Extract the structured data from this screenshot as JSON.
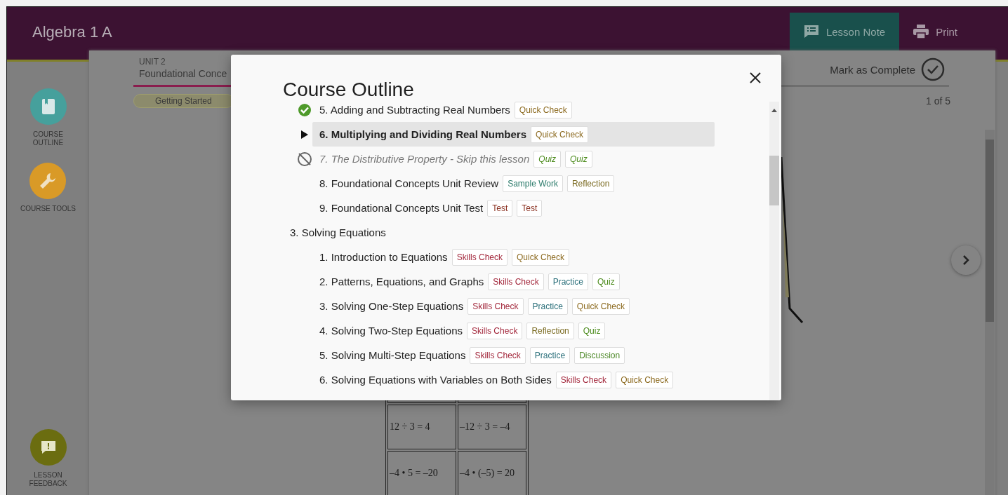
{
  "header": {
    "title": "Algebra 1 A",
    "actions": [
      {
        "label": "Lesson Note",
        "kind": "note",
        "selected": true
      },
      {
        "label": "Print",
        "kind": "print",
        "selected": false
      }
    ]
  },
  "sidebar": {
    "top": [
      {
        "label": "COURSE OUTLINE",
        "kind": "book"
      },
      {
        "label": "COURSE TOOLS",
        "kind": "wrench"
      }
    ],
    "bottom": [
      {
        "label": "LESSON FEEDBACK",
        "kind": "feedback"
      }
    ]
  },
  "unit": {
    "label": "UNIT 2",
    "title": "Foundational Conce"
  },
  "step_tabs": [
    {
      "label": "Getting Started",
      "selected": true
    }
  ],
  "mark_complete": {
    "label": "Mark as Complete",
    "checked": false
  },
  "page_counter": "1 of 5",
  "table": {
    "rows": [
      {
        "cells": [
          "12 ÷ 3 = 4",
          "–12 ÷ 3 = –4"
        ]
      },
      {
        "cells": [
          "–4 • 5 = –20",
          "–4 • (–5) = 20"
        ]
      }
    ]
  },
  "course_outline": {
    "title": "Course Outline",
    "units": [
      {
        "lessons": [
          {
            "title": "5. Adding and Subtracting Real Numbers",
            "kind": "complete",
            "selected": false,
            "tags": [
              {
                "label": "Quick Check",
                "kind": "quick_check"
              }
            ]
          },
          {
            "title": "6. Multiplying and Dividing Real Numbers",
            "kind": "current",
            "selected": true,
            "tags": [
              {
                "label": "Quick Check",
                "kind": "quick_check"
              }
            ]
          },
          {
            "title": "7. The Distributive Property - Skip this lesson",
            "kind": "skipped",
            "selected": false,
            "tags": [
              {
                "label": "Quiz",
                "kind": "quiz"
              },
              {
                "label": "Quiz",
                "kind": "quiz"
              }
            ]
          },
          {
            "title": "8. Foundational Concepts Unit Review",
            "kind": "plain",
            "selected": false,
            "tags": [
              {
                "label": "Sample Work",
                "kind": "sample_work"
              },
              {
                "label": "Reflection",
                "kind": "reflection"
              }
            ]
          },
          {
            "title": "9. Foundational Concepts Unit Test",
            "kind": "plain",
            "selected": false,
            "tags": [
              {
                "label": "Test",
                "kind": "test"
              },
              {
                "label": "Test",
                "kind": "test"
              }
            ]
          }
        ]
      },
      {
        "title": "3. Solving Equations",
        "lessons": [
          {
            "title": "1. Introduction to Equations",
            "kind": "plain",
            "selected": false,
            "tags": [
              {
                "label": "Skills Check",
                "kind": "skills_check"
              },
              {
                "label": "Quick Check",
                "kind": "quick_check"
              }
            ]
          },
          {
            "title": "2. Patterns, Equations, and Graphs",
            "kind": "plain",
            "selected": false,
            "tags": [
              {
                "label": "Skills Check",
                "kind": "skills_check"
              },
              {
                "label": "Practice",
                "kind": "practice"
              },
              {
                "label": "Quiz",
                "kind": "quiz"
              }
            ]
          },
          {
            "title": "3. Solving One-Step Equations",
            "kind": "plain",
            "selected": false,
            "tags": [
              {
                "label": "Skills Check",
                "kind": "skills_check"
              },
              {
                "label": "Practice",
                "kind": "practice"
              },
              {
                "label": "Quick Check",
                "kind": "quick_check"
              }
            ]
          },
          {
            "title": "4. Solving Two-Step Equations",
            "kind": "plain",
            "selected": false,
            "tags": [
              {
                "label": "Skills Check",
                "kind": "skills_check"
              },
              {
                "label": "Reflection",
                "kind": "reflection"
              },
              {
                "label": "Quiz",
                "kind": "quiz"
              }
            ]
          },
          {
            "title": "5. Solving Multi-Step Equations",
            "kind": "plain",
            "selected": false,
            "tags": [
              {
                "label": "Skills Check",
                "kind": "skills_check"
              },
              {
                "label": "Practice",
                "kind": "practice"
              },
              {
                "label": "Discussion",
                "kind": "discussion"
              }
            ]
          },
          {
            "title": "6. Solving Equations with Variables on Both Sides",
            "kind": "plain",
            "selected": false,
            "tags": [
              {
                "label": "Skills Check",
                "kind": "skills_check"
              },
              {
                "label": "Quick Check",
                "kind": "quick_check"
              }
            ]
          }
        ]
      }
    ]
  }
}
